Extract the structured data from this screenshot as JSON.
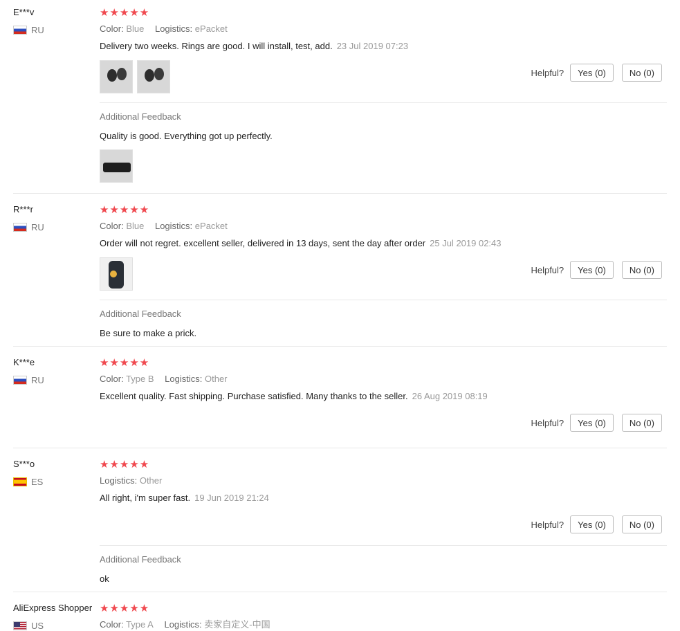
{
  "helpful_label": "Helpful?",
  "colors": {
    "star": "#f0494f",
    "divider": "#e8e8e8"
  },
  "reviews": [
    {
      "user": "E***v",
      "country": "RU",
      "flag": "flag-ru-icon",
      "stars": "★★★★★",
      "color_label": "Color:",
      "color_value": "Blue",
      "logistics_label": "Logistics:",
      "logistics_value": "ePacket",
      "text": "Delivery two weeks. Rings are good. I will install, test, add.",
      "date": "23 Jul 2019 07:23",
      "yes": "Yes (0)",
      "no": "No (0)",
      "additional_title": "Additional Feedback",
      "additional_text": "Quality is good. Everything got up perfectly."
    },
    {
      "user": "R***r",
      "country": "RU",
      "flag": "flag-ru-icon",
      "stars": "★★★★★",
      "color_label": "Color:",
      "color_value": "Blue",
      "logistics_label": "Logistics:",
      "logistics_value": "ePacket",
      "text": "Order will not regret. excellent seller, delivered in 13 days, sent the day after order",
      "date": "25 Jul 2019 02:43",
      "yes": "Yes (0)",
      "no": "No (0)",
      "additional_title": "Additional Feedback",
      "additional_text": "Be sure to make a prick."
    },
    {
      "user": "K***e",
      "country": "RU",
      "flag": "flag-ru-icon",
      "stars": "★★★★★",
      "color_label": "Color:",
      "color_value": "Type B",
      "logistics_label": "Logistics:",
      "logistics_value": "Other",
      "text": "Excellent quality. Fast shipping. Purchase satisfied. Many thanks to the seller.",
      "date": "26 Aug 2019 08:19",
      "yes": "Yes (0)",
      "no": "No (0)"
    },
    {
      "user": "S***o",
      "country": "ES",
      "flag": "flag-es-icon",
      "stars": "★★★★★",
      "logistics_label": "Logistics:",
      "logistics_value": "Other",
      "text": "All right, i'm super fast.",
      "date": "19 Jun 2019 21:24",
      "yes": "Yes (0)",
      "no": "No (0)",
      "additional_title": "Additional Feedback",
      "additional_text": "ok"
    },
    {
      "user": "AliExpress Shopper",
      "country": "US",
      "flag": "flag-us-icon",
      "stars": "★★★★★",
      "color_label": "Color:",
      "color_value": "Type A",
      "logistics_label": "Logistics:",
      "logistics_value": "卖家自定义-中国"
    }
  ]
}
